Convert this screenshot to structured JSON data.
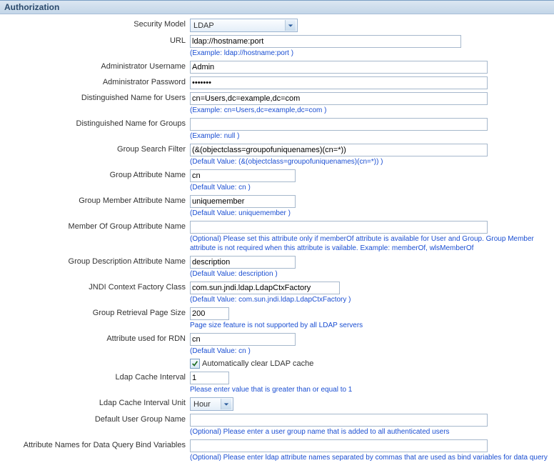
{
  "panel_title": "Authorization",
  "labels": {
    "security_model": "Security Model",
    "url": "URL",
    "admin_user": "Administrator Username",
    "admin_pass": "Administrator Password",
    "dn_users": "Distinguished Name for Users",
    "dn_groups": "Distinguished Name for Groups",
    "group_search": "Group Search Filter",
    "group_attr": "Group Attribute Name",
    "group_member_attr": "Group Member Attribute Name",
    "memberof_attr": "Member Of Group Attribute Name",
    "group_desc_attr": "Group Description Attribute Name",
    "jndi": "JNDI Context Factory Class",
    "page_size": "Group Retrieval Page Size",
    "rdn": "Attribute used for RDN",
    "auto_clear": "Automatically clear LDAP cache",
    "cache_interval": "Ldap Cache Interval",
    "cache_unit": "Ldap Cache Interval Unit",
    "default_group": "Default User Group Name",
    "bind_vars": "Attribute Names for Data Query Bind Variables"
  },
  "values": {
    "security_model": "LDAP",
    "url": "ldap://hostname:port",
    "admin_user": "Admin",
    "admin_pass": "•••••••",
    "dn_users": "cn=Users,dc=example,dc=com",
    "dn_groups": "",
    "group_search": "(&(objectclass=groupofuniquenames)(cn=*))",
    "group_attr": "cn",
    "group_member_attr": "uniquemember",
    "memberof_attr": "",
    "group_desc_attr": "description",
    "jndi": "com.sun.jndi.ldap.LdapCtxFactory",
    "page_size": "200",
    "rdn": "cn",
    "auto_clear": true,
    "cache_interval": "1",
    "cache_unit": "Hour",
    "default_group": "",
    "bind_vars": ""
  },
  "hints": {
    "url": "(Example: ldap://hostname:port )",
    "dn_users": "(Example: cn=Users,dc=example,dc=com )",
    "dn_groups": "(Example: null )",
    "group_search": "(Default Value: (&(objectclass=groupofuniquenames)(cn=*)) )",
    "group_attr": "(Default Value: cn )",
    "group_member_attr": "(Default Value: uniquemember )",
    "memberof_attr": "(Optional) Please set this attribute only if memberOf attribute is available for User and Group. Group Member attribute is not required when this attribute is vailable. Example: memberOf, wlsMemberOf",
    "group_desc_attr": "(Default Value: description )",
    "jndi": "(Default Value: com.sun.jndi.ldap.LdapCtxFactory )",
    "page_size": "Page size feature is not supported by all LDAP servers",
    "rdn": "(Default Value: cn )",
    "cache_interval": "Please enter value that is greater than or equal to 1",
    "default_group": "(Optional) Please enter a user group name that is added to all authenticated users",
    "bind_vars": "(Optional) Please enter ldap attribute names separated by commas that are used as bind variables for data query"
  }
}
